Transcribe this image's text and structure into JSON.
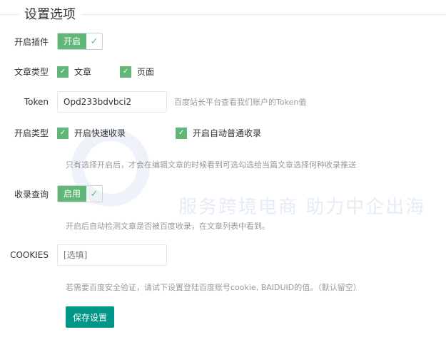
{
  "section_title": "设置选项",
  "watermark": {
    "tagline": "服务跨境电商 助力中企出海"
  },
  "plugin": {
    "label": "开启插件",
    "switch_text": "开启"
  },
  "post_type": {
    "label": "文章类型",
    "options": [
      "文章",
      "页面"
    ]
  },
  "token": {
    "label": "Token",
    "value": "Opd233bdvbci2",
    "hint": "百度站长平台查看我们账户的Token值"
  },
  "push_type": {
    "label": "开启类型",
    "options": [
      "开启快速收录",
      "开启自动普通收录"
    ],
    "hint": "只有选择开启后，才会在编辑文章的时候看到可选勾选给当篇文章选择何种收录推送"
  },
  "index_query": {
    "label": "收录查询",
    "switch_text": "启用",
    "hint": "开启后自动检测文章是否被百度收录，在文章列表中看到。"
  },
  "cookies": {
    "label": "COOKIES",
    "placeholder": "[选填]",
    "hint": "若需要百度安全验证，请试下设置登陆百度账号cookie, BAIDUID的值。（默认留空）"
  },
  "save_label": "保存设置"
}
